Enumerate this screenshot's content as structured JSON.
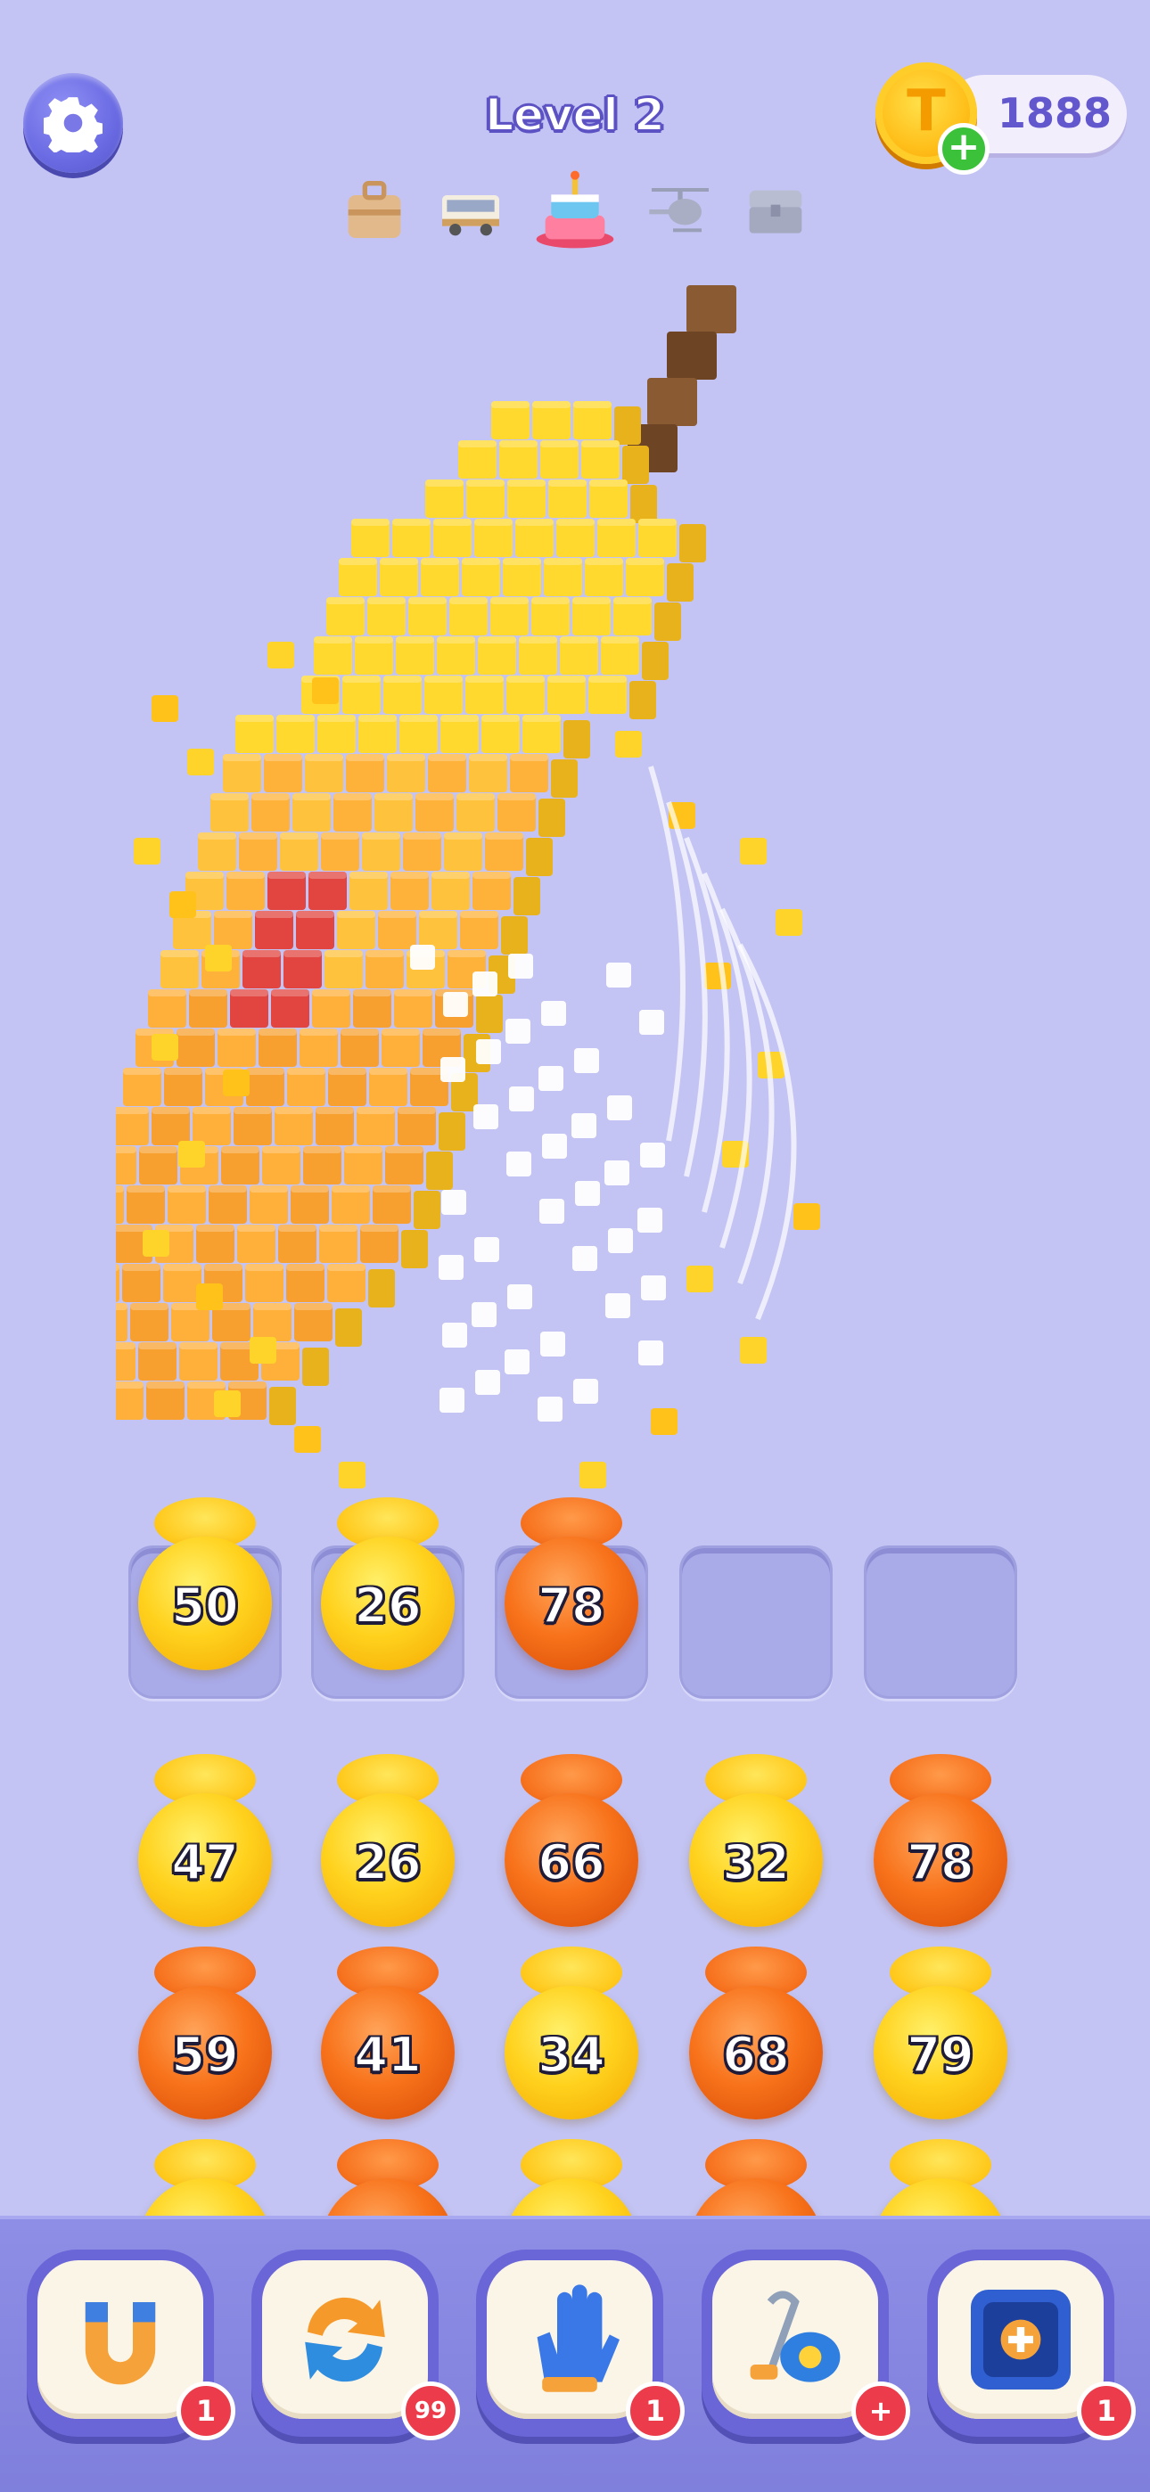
{
  "header": {
    "level_title": "Level 2",
    "coin_count": "1888",
    "coin_add_label": "+",
    "stages": [
      {
        "icon": "suitcase-icon",
        "state": "done"
      },
      {
        "icon": "truck-icon",
        "state": "done"
      },
      {
        "icon": "cake-icon",
        "state": "current"
      },
      {
        "icon": "helicopter-icon",
        "state": "locked"
      },
      {
        "icon": "chest-icon",
        "state": "locked"
      }
    ]
  },
  "model": {
    "icon": "voxel-banana"
  },
  "tray": {
    "slots": [
      {
        "value": "50",
        "color": "yellow"
      },
      {
        "value": "26",
        "color": "yellow"
      },
      {
        "value": "78",
        "color": "orange"
      },
      {
        "value": "",
        "color": "empty"
      },
      {
        "value": "",
        "color": "empty"
      }
    ]
  },
  "grid": {
    "rows": [
      [
        {
          "value": "47",
          "color": "yellow"
        },
        {
          "value": "26",
          "color": "yellow"
        },
        {
          "value": "66",
          "color": "orange"
        },
        {
          "value": "32",
          "color": "yellow"
        },
        {
          "value": "78",
          "color": "orange"
        }
      ],
      [
        {
          "value": "59",
          "color": "orange"
        },
        {
          "value": "41",
          "color": "orange"
        },
        {
          "value": "34",
          "color": "yellow"
        },
        {
          "value": "68",
          "color": "orange"
        },
        {
          "value": "79",
          "color": "yellow"
        }
      ],
      [
        {
          "value": "",
          "color": "yellow"
        },
        {
          "value": "",
          "color": "orange"
        },
        {
          "value": "",
          "color": "yellow"
        },
        {
          "value": "",
          "color": "orange"
        },
        {
          "value": "",
          "color": "yellow"
        }
      ]
    ]
  },
  "boosters": [
    {
      "icon": "magnet-icon",
      "badge": "1"
    },
    {
      "icon": "shuffle-icon",
      "badge": "99"
    },
    {
      "icon": "glove-icon",
      "badge": "1"
    },
    {
      "icon": "vacuum-icon",
      "badge": "+"
    },
    {
      "icon": "add-slot-icon",
      "badge": "1"
    }
  ],
  "colors": {
    "background": "#c3c4f3",
    "yellow_ball": "#ffd21e",
    "orange_ball": "#f8731b",
    "accent": "#6a66d8",
    "badge": "#ec3b4a"
  }
}
